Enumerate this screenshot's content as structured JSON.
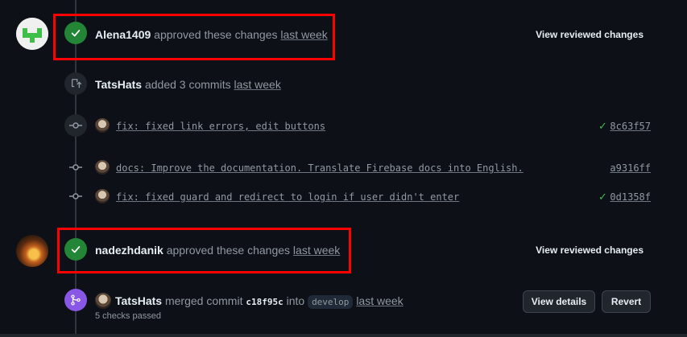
{
  "reviews": [
    {
      "user": "Alena1409",
      "action": "approved these changes",
      "time": "last week",
      "button": "View reviewed changes"
    },
    {
      "user": "nadezhdanik",
      "action": "approved these changes",
      "time": "last week",
      "button": "View reviewed changes"
    }
  ],
  "commits_event": {
    "user": "TatsHats",
    "action": "added 3 commits",
    "time": "last week"
  },
  "commits": [
    {
      "message": "fix: fixed link errors, edit buttons",
      "sha": "8c63f57",
      "checks": "passed"
    },
    {
      "message": "docs: Improve the documentation. Translate Firebase docs into English.",
      "sha": "a9316ff",
      "checks": ""
    },
    {
      "message": "fix: fixed guard and redirect to login if user didn't enter",
      "sha": "0d1358f",
      "checks": "passed"
    }
  ],
  "merge_event": {
    "user": "TatsHats",
    "action": "merged commit",
    "commit": "c18f95c",
    "into_word": "into",
    "branch": "develop",
    "time": "last week",
    "checks_summary": "5 checks passed",
    "details_button": "View details",
    "revert_button": "Revert"
  },
  "colors": {
    "background": "#0d1117",
    "approved_badge": "#238636",
    "merge_badge": "#8957e5",
    "highlight": "#ff0000",
    "check": "#3fb950"
  }
}
